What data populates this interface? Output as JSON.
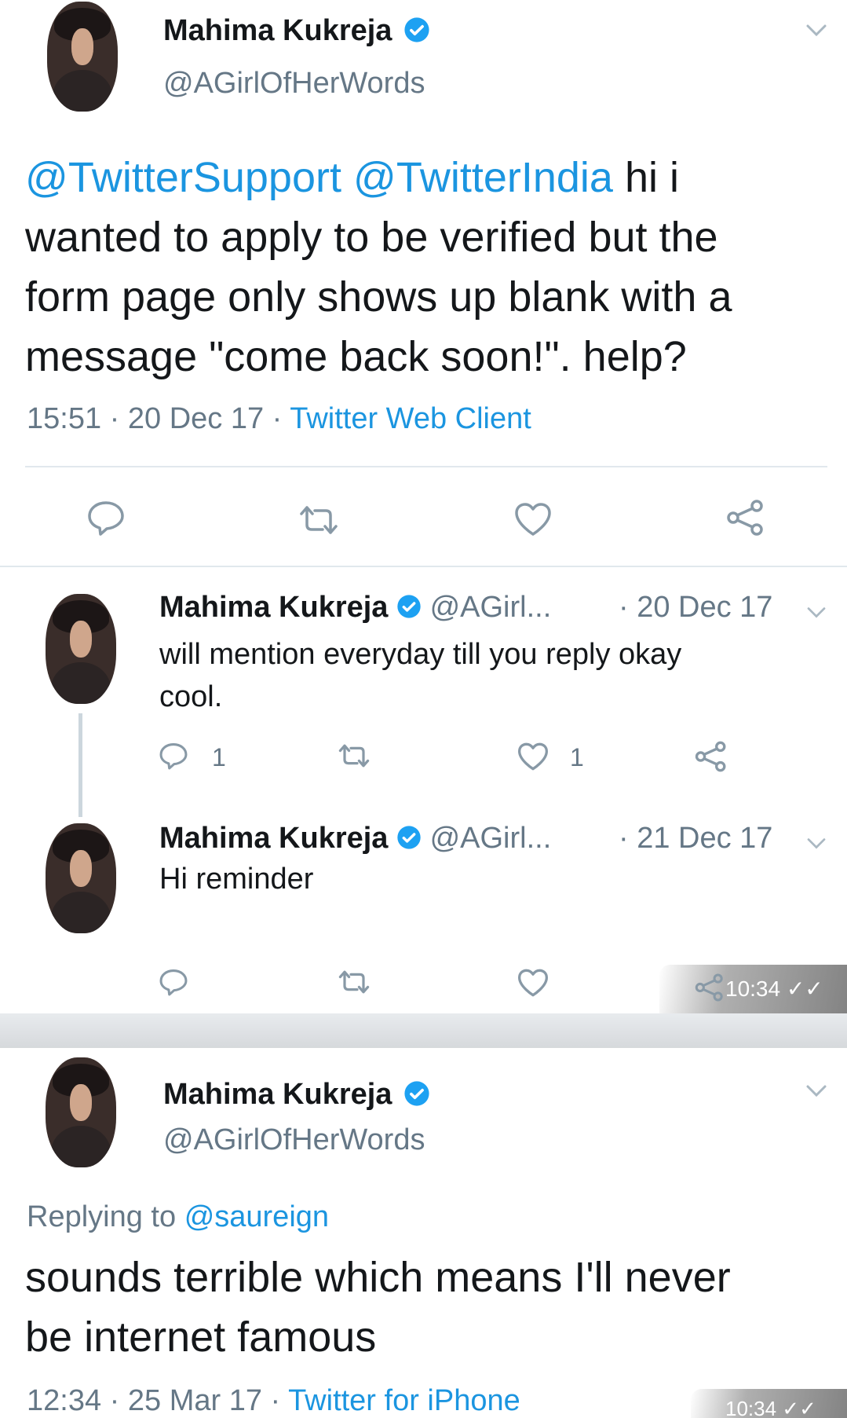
{
  "tweet1": {
    "name": "Mahima Kukreja",
    "handle": "@AGirlOfHerWords",
    "mention1": "@TwitterSupport",
    "mention2": "@TwitterIndia",
    "body_line1_rest": "hi i",
    "body_line2": "wanted to apply to be verified but the",
    "body_line3": "form page only shows up blank with a",
    "body_line4": "message \"come back soon!\". help?",
    "time": "15:51",
    "date": "20 Dec 17",
    "client": "Twitter Web Client"
  },
  "reply1": {
    "name": "Mahima Kukreja",
    "handle": "@AGirl...",
    "date": "· 20 Dec 17",
    "text_line1": "will mention everyday till you reply okay",
    "text_line2": "cool.",
    "reply_count": "1",
    "like_count": "1"
  },
  "reply2": {
    "name": "Mahima Kukreja",
    "handle": "@AGirl...",
    "date": "· 21 Dec 17",
    "text": "Hi reminder",
    "overlay_time": "10:34 ✓✓"
  },
  "tweet2": {
    "name": "Mahima Kukreja",
    "handle": "@AGirlOfHerWords",
    "replying_prefix": "Replying to",
    "replying_to": "@saureign",
    "body_line1": "sounds terrible which means I'll never",
    "body_line2": "be internet famous",
    "time": "12:34",
    "date": "25 Mar 17",
    "client": "Twitter for iPhone",
    "overlay_time": "10:34 ✓✓"
  },
  "colors": {
    "link": "#1b95e0",
    "verified": "#1da1f2",
    "muted": "#657786",
    "text": "#14171a"
  },
  "icons": [
    "reply-icon",
    "retweet-icon",
    "like-icon",
    "share-icon",
    "verified-badge-icon",
    "chevron-down-icon"
  ]
}
